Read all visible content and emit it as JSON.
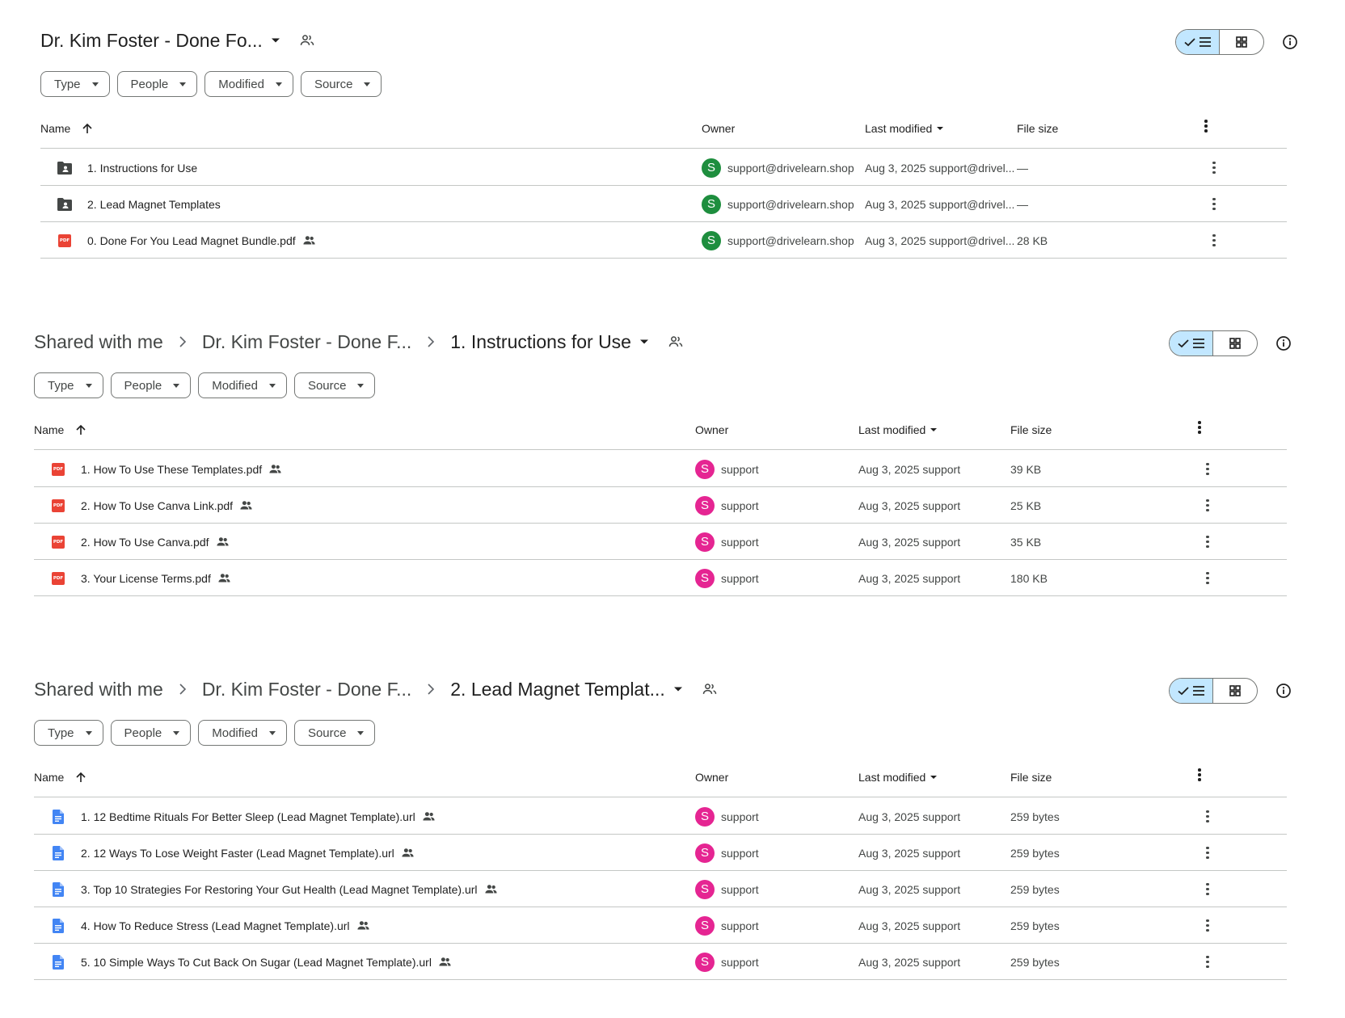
{
  "colors": {
    "toggle_active_bg": "#c2e7ff",
    "owner_green": "#1e8e3e",
    "owner_pink": "#e52592",
    "pdf_red": "#ea4335",
    "doc_blue": "#4285f4"
  },
  "filters": [
    "Type",
    "People",
    "Modified",
    "Source"
  ],
  "columns": {
    "name": "Name",
    "owner": "Owner",
    "last_modified": "Last modified",
    "file_size": "File size"
  },
  "panels": [
    {
      "breadcrumbs": [],
      "title": "Dr. Kim Foster - Done Fo...",
      "files": [
        {
          "icon": "shared-folder-icon",
          "name": "1. Instructions for Use",
          "shared": false,
          "owner_initial": "S",
          "owner": "support@drivelearn.shop",
          "modified": "Aug 3, 2025 support@drivel...",
          "size": "—"
        },
        {
          "icon": "shared-folder-icon",
          "name": "2. Lead Magnet Templates",
          "shared": false,
          "owner_initial": "S",
          "owner": "support@drivelearn.shop",
          "modified": "Aug 3, 2025 support@drivel...",
          "size": "—"
        },
        {
          "icon": "pdf-icon",
          "name": "0. Done For You Lead Magnet Bundle.pdf",
          "shared": true,
          "owner_initial": "S",
          "owner": "support@drivelearn.shop",
          "modified": "Aug 3, 2025 support@drivel...",
          "size": "28 KB"
        }
      ]
    },
    {
      "breadcrumbs": [
        "Shared with me",
        "Dr. Kim Foster - Done F..."
      ],
      "title": "1. Instructions for Use",
      "files": [
        {
          "icon": "pdf-icon",
          "name": "1. How To Use These Templates.pdf",
          "shared": true,
          "owner_initial": "S",
          "owner": "support",
          "modified": "Aug 3, 2025 support",
          "size": "39 KB"
        },
        {
          "icon": "pdf-icon",
          "name": "2. How To Use Canva Link.pdf",
          "shared": true,
          "owner_initial": "S",
          "owner": "support",
          "modified": "Aug 3, 2025 support",
          "size": "25 KB"
        },
        {
          "icon": "pdf-icon",
          "name": "2. How To Use Canva.pdf",
          "shared": true,
          "owner_initial": "S",
          "owner": "support",
          "modified": "Aug 3, 2025 support",
          "size": "35 KB"
        },
        {
          "icon": "pdf-icon",
          "name": "3. Your License Terms.pdf",
          "shared": true,
          "owner_initial": "S",
          "owner": "support",
          "modified": "Aug 3, 2025 support",
          "size": "180 KB"
        }
      ]
    },
    {
      "breadcrumbs": [
        "Shared with me",
        "Dr. Kim Foster - Done F..."
      ],
      "title": "2. Lead Magnet Templat...",
      "files": [
        {
          "icon": "doc-icon",
          "name": "1. 12 Bedtime Rituals For Better Sleep (Lead Magnet Template).url",
          "shared": true,
          "owner_initial": "S",
          "owner": "support",
          "modified": "Aug 3, 2025 support",
          "size": "259 bytes"
        },
        {
          "icon": "doc-icon",
          "name": "2. 12 Ways To Lose Weight Faster (Lead Magnet Template).url",
          "shared": true,
          "owner_initial": "S",
          "owner": "support",
          "modified": "Aug 3, 2025 support",
          "size": "259 bytes"
        },
        {
          "icon": "doc-icon",
          "name": "3. Top 10 Strategies For Restoring Your Gut Health (Lead Magnet Template).url",
          "shared": true,
          "owner_initial": "S",
          "owner": "support",
          "modified": "Aug 3, 2025 support",
          "size": "259 bytes"
        },
        {
          "icon": "doc-icon",
          "name": "4. How To Reduce Stress (Lead Magnet Template).url",
          "shared": true,
          "owner_initial": "S",
          "owner": "support",
          "modified": "Aug 3, 2025 support",
          "size": "259 bytes"
        },
        {
          "icon": "doc-icon",
          "name": "5. 10 Simple Ways To Cut Back On Sugar (Lead Magnet Template).url",
          "shared": true,
          "owner_initial": "S",
          "owner": "support",
          "modified": "Aug 3, 2025 support",
          "size": "259 bytes"
        }
      ]
    }
  ]
}
